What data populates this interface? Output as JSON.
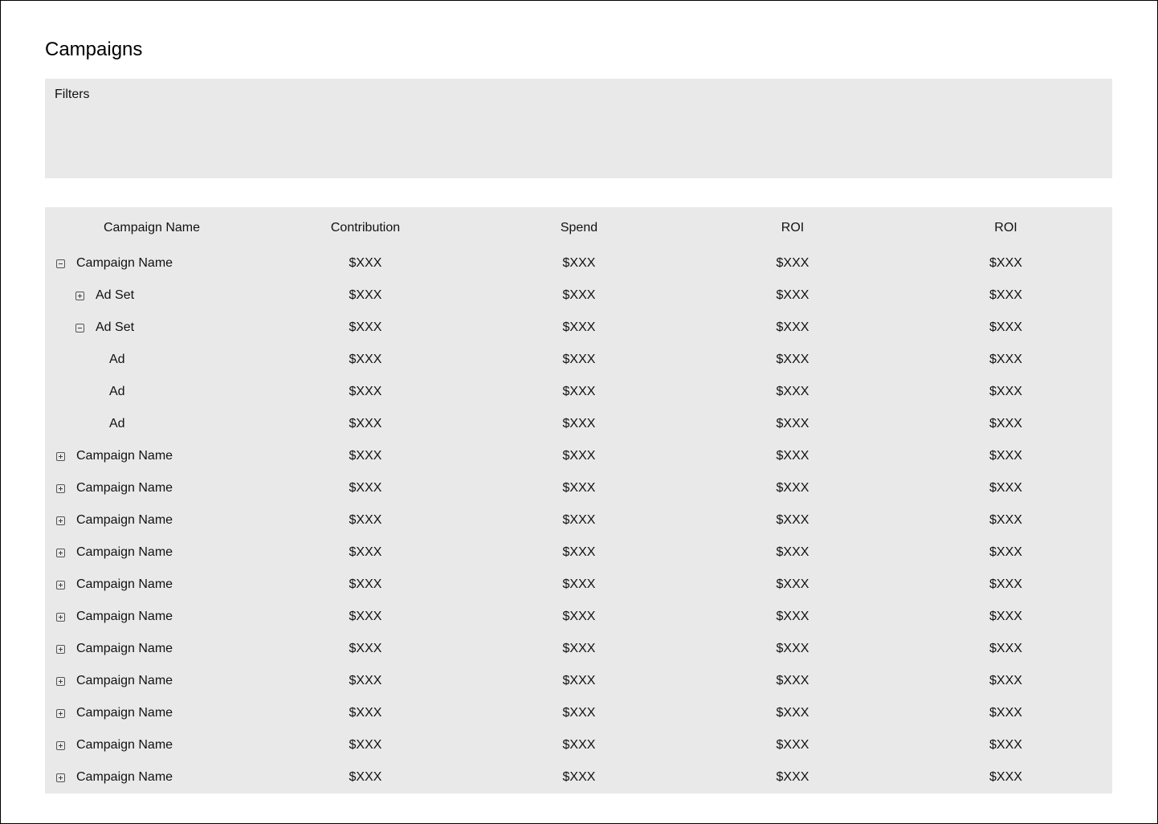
{
  "page": {
    "title": "Campaigns"
  },
  "filters": {
    "label": "Filters"
  },
  "table": {
    "columns": [
      "Campaign Name",
      "Contribution",
      "Spend",
      "ROI",
      "ROI"
    ],
    "rows": [
      {
        "level": 0,
        "toggle": "collapse",
        "name": "Campaign Name",
        "values": [
          "$XXX",
          "$XXX",
          "$XXX",
          "$XXX"
        ]
      },
      {
        "level": 1,
        "toggle": "expand",
        "name": "Ad Set",
        "values": [
          "$XXX",
          "$XXX",
          "$XXX",
          "$XXX"
        ]
      },
      {
        "level": 1,
        "toggle": "collapse",
        "name": "Ad Set",
        "values": [
          "$XXX",
          "$XXX",
          "$XXX",
          "$XXX"
        ]
      },
      {
        "level": 2,
        "toggle": "none",
        "name": "Ad",
        "values": [
          "$XXX",
          "$XXX",
          "$XXX",
          "$XXX"
        ]
      },
      {
        "level": 2,
        "toggle": "none",
        "name": "Ad",
        "values": [
          "$XXX",
          "$XXX",
          "$XXX",
          "$XXX"
        ]
      },
      {
        "level": 2,
        "toggle": "none",
        "name": "Ad",
        "values": [
          "$XXX",
          "$XXX",
          "$XXX",
          "$XXX"
        ]
      },
      {
        "level": 0,
        "toggle": "expand",
        "name": "Campaign Name",
        "values": [
          "$XXX",
          "$XXX",
          "$XXX",
          "$XXX"
        ]
      },
      {
        "level": 0,
        "toggle": "expand",
        "name": "Campaign Name",
        "values": [
          "$XXX",
          "$XXX",
          "$XXX",
          "$XXX"
        ]
      },
      {
        "level": 0,
        "toggle": "expand",
        "name": "Campaign Name",
        "values": [
          "$XXX",
          "$XXX",
          "$XXX",
          "$XXX"
        ]
      },
      {
        "level": 0,
        "toggle": "expand",
        "name": "Campaign Name",
        "values": [
          "$XXX",
          "$XXX",
          "$XXX",
          "$XXX"
        ]
      },
      {
        "level": 0,
        "toggle": "expand",
        "name": "Campaign Name",
        "values": [
          "$XXX",
          "$XXX",
          "$XXX",
          "$XXX"
        ]
      },
      {
        "level": 0,
        "toggle": "expand",
        "name": "Campaign Name",
        "values": [
          "$XXX",
          "$XXX",
          "$XXX",
          "$XXX"
        ]
      },
      {
        "level": 0,
        "toggle": "expand",
        "name": "Campaign Name",
        "values": [
          "$XXX",
          "$XXX",
          "$XXX",
          "$XXX"
        ]
      },
      {
        "level": 0,
        "toggle": "expand",
        "name": "Campaign Name",
        "values": [
          "$XXX",
          "$XXX",
          "$XXX",
          "$XXX"
        ]
      },
      {
        "level": 0,
        "toggle": "expand",
        "name": "Campaign Name",
        "values": [
          "$XXX",
          "$XXX",
          "$XXX",
          "$XXX"
        ]
      },
      {
        "level": 0,
        "toggle": "expand",
        "name": "Campaign Name",
        "values": [
          "$XXX",
          "$XXX",
          "$XXX",
          "$XXX"
        ]
      },
      {
        "level": 0,
        "toggle": "expand",
        "name": "Campaign Name",
        "values": [
          "$XXX",
          "$XXX",
          "$XXX",
          "$XXX"
        ]
      }
    ]
  },
  "icons": {
    "collapse": "minus-square-icon",
    "expand": "plus-square-icon"
  },
  "colors": {
    "panel_background": "#e9e9e9",
    "frame_border": "#000000"
  }
}
